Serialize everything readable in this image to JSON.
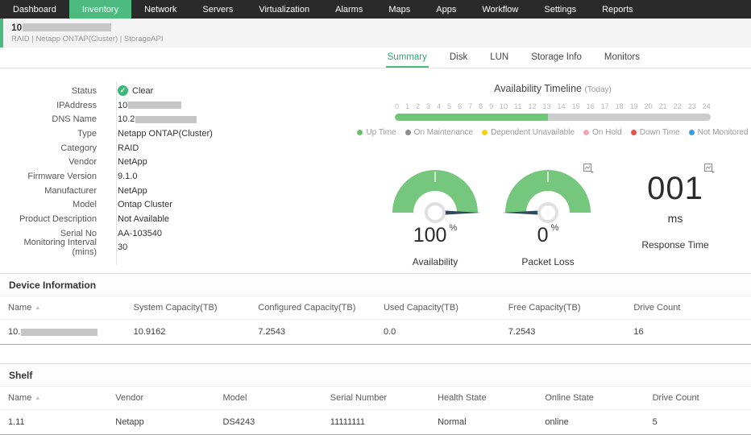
{
  "nav": {
    "active": "Inventory",
    "items": [
      {
        "label": "Dashboard"
      },
      {
        "label": "Inventory"
      },
      {
        "label": "Network"
      },
      {
        "label": "Servers"
      },
      {
        "label": "Virtualization"
      },
      {
        "label": "Alarms"
      },
      {
        "label": "Maps"
      },
      {
        "label": "Apps"
      },
      {
        "label": "Workflow"
      },
      {
        "label": "Settings"
      },
      {
        "label": "Reports"
      }
    ]
  },
  "device_header": {
    "title": "10",
    "subtitle": "RAID | Netapp ONTAP(Cluster)  | StorageAPI"
  },
  "tabs": {
    "active": "Summary",
    "items": [
      {
        "label": "Summary"
      },
      {
        "label": "Disk"
      },
      {
        "label": "LUN"
      },
      {
        "label": "Storage Info"
      },
      {
        "label": "Monitors"
      }
    ]
  },
  "details": {
    "rows": [
      {
        "label": "Status",
        "value": "Clear"
      },
      {
        "label": "IPAddress",
        "value": "10"
      },
      {
        "label": "DNS Name",
        "value": "10.2"
      },
      {
        "label": "Type",
        "value": "Netapp ONTAP(Cluster)"
      },
      {
        "label": "Category",
        "value": "RAID"
      },
      {
        "label": "Vendor",
        "value": "NetApp"
      },
      {
        "label": "Firmware Version",
        "value": "9.1.0"
      },
      {
        "label": "Manufacturer",
        "value": "NetApp"
      },
      {
        "label": "Model",
        "value": "Ontap Cluster"
      },
      {
        "label": "Product Description",
        "value": "Not Available"
      },
      {
        "label": "Serial No",
        "value": "AA-103540"
      },
      {
        "label": "Monitoring Interval (mins)",
        "value": "30"
      }
    ]
  },
  "timeline": {
    "title": "Availability Timeline",
    "subtitle": "(Today)",
    "hours": [
      "0",
      "1",
      "2",
      "3",
      "4",
      "5",
      "6",
      "7",
      "8",
      "9",
      "10",
      "11",
      "12",
      "13",
      "14",
      "15",
      "16",
      "17",
      "18",
      "19",
      "20",
      "21",
      "22",
      "23",
      "24"
    ],
    "uptime_percent": 48.5,
    "uptime_color": "#6ec877",
    "track_color": "#cccccc",
    "legend": [
      {
        "label": "Up Time",
        "color": "#6abf69"
      },
      {
        "label": "On Maintenance",
        "color": "#8c8c8c"
      },
      {
        "label": "Dependent Unavailable",
        "color": "#f6d414"
      },
      {
        "label": "On Hold",
        "color": "#f4a6b8"
      },
      {
        "label": "Down Time",
        "color": "#e85445"
      },
      {
        "label": "Not Monitored",
        "color": "#3e9bdc"
      }
    ]
  },
  "metrics": {
    "gauge_color": "#74c77c",
    "needle_color": "#31475c",
    "availability": {
      "value": "100",
      "unit": "%",
      "label": "Availability",
      "percent": 100
    },
    "packet_loss": {
      "value": "0",
      "unit": "%",
      "label": "Packet Loss",
      "percent": 0
    },
    "response_time": {
      "value": "001",
      "unit": "ms",
      "label": "Response Time"
    }
  },
  "device_information": {
    "title": "Device Information",
    "columns": [
      "Name",
      "System Capacity(TB)",
      "Configured Capacity(TB)",
      "Used Capacity(TB)",
      "Free Capacity(TB)",
      "Drive Count"
    ],
    "rows": [
      {
        "name": "10.",
        "system_capacity": "10.9162",
        "configured_capacity": "7.2543",
        "used_capacity": "0.0",
        "free_capacity": "7.2543",
        "drive_count": "16"
      }
    ]
  },
  "shelf": {
    "title": "Shelf",
    "columns": [
      "Name",
      "Vendor",
      "Model",
      "Serial Number",
      "Health State",
      "Online State",
      "Drive Count"
    ],
    "rows": [
      {
        "name": "1.11",
        "vendor": "Netapp",
        "model": "DS4243",
        "serial_number": "11111111",
        "health_state": "Normal",
        "online_state": "online",
        "drive_count": "5"
      }
    ]
  }
}
